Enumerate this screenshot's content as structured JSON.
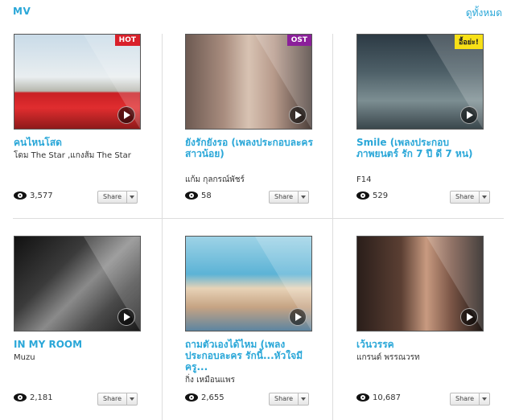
{
  "header": {
    "title": "MV",
    "see_all": "ดูทั้งหมด"
  },
  "videos": [
    {
      "title": "คนไหนโสด",
      "artist": "โดม The Star ,แกงส้ม The Star",
      "views": "3,577",
      "badge": "HOT",
      "badge_color": "#d9202a",
      "share_label": "Share"
    },
    {
      "title": "ยังรักยังรอ (เพลงประกอบละคร สาวน้อย)",
      "artist": "แก้ม กุลกรณ์พัชร์",
      "views": "58",
      "badge": "OST",
      "badge_color": "#8b1f9a",
      "share_label": "Share"
    },
    {
      "title": "Smile (เพลงประกอบภาพยนตร์ รัก 7 ปี ดี 7 หน)",
      "artist": "F14",
      "views": "529",
      "badge": "อื้อย่ะ!",
      "badge_color": "#f7e017",
      "share_label": "Share"
    },
    {
      "title": "IN MY ROOM",
      "artist": "Muzu",
      "views": "2,181",
      "badge": "",
      "badge_color": "",
      "share_label": "Share"
    },
    {
      "title": "ถามตัวเองได้ไหม (เพลงประกอบละคร รักนี้...หัวใจมีครู...",
      "artist": "กิ่ง เหมือนแพร",
      "views": "2,655",
      "badge": "",
      "badge_color": "",
      "share_label": "Share"
    },
    {
      "title": "เว้นวรรค",
      "artist": "แกรนด์ พรรณวรท",
      "views": "10,687",
      "badge": "",
      "badge_color": "",
      "share_label": "Share"
    }
  ]
}
